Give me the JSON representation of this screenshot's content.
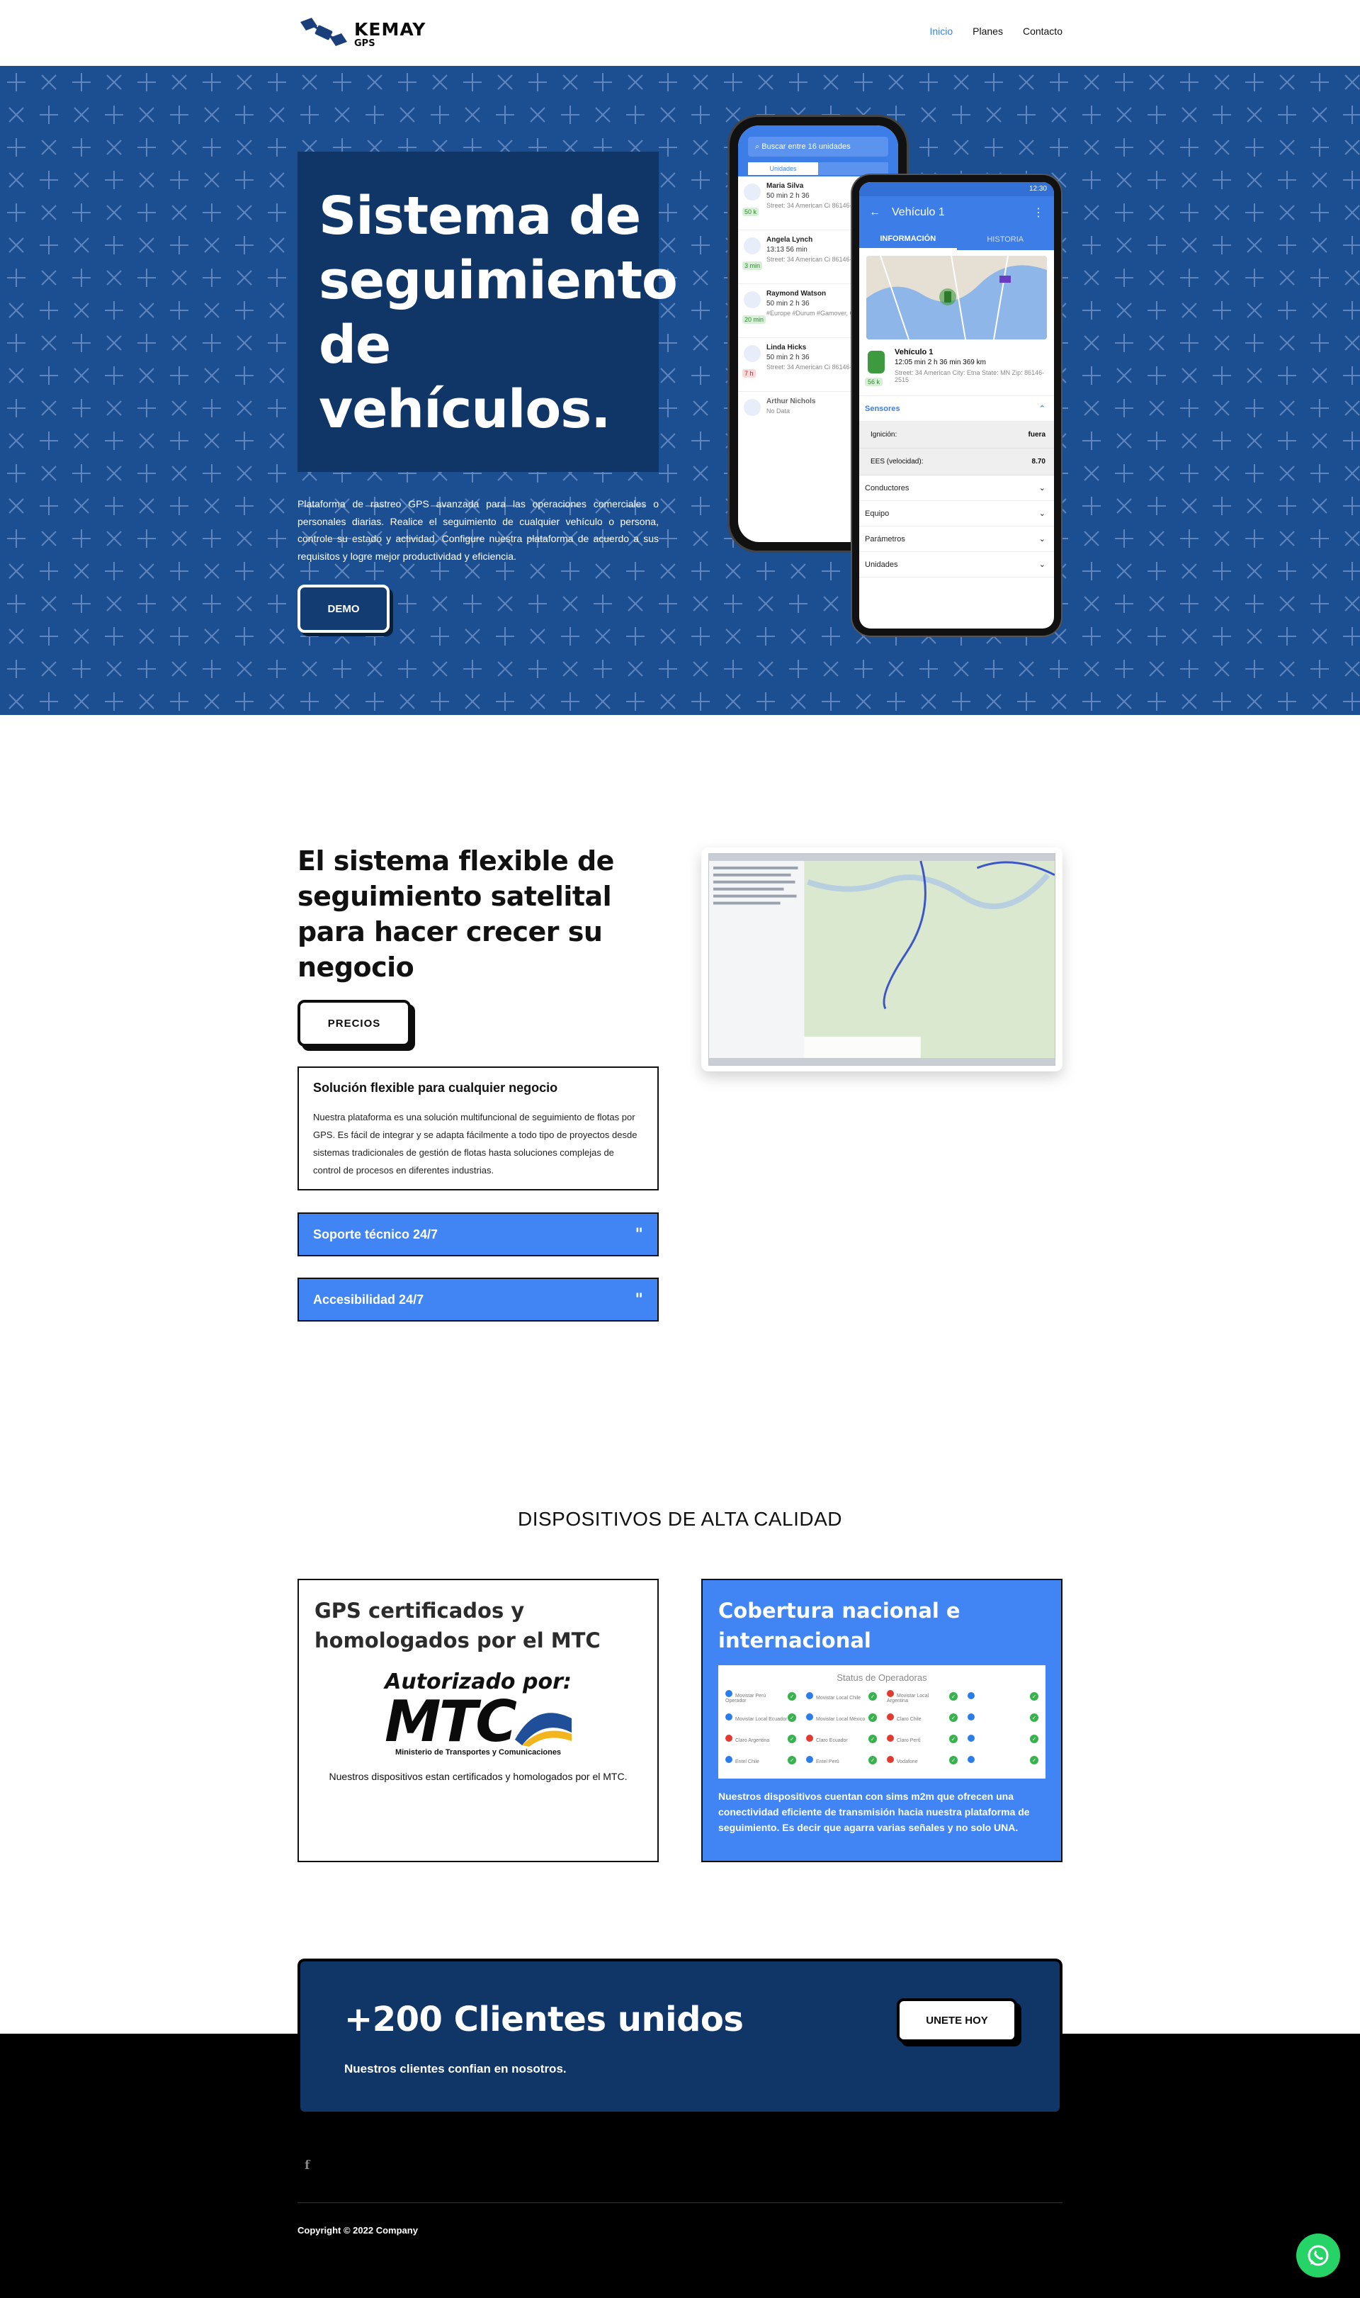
{
  "header": {
    "logo_name": "KEMAY",
    "logo_sub": "GPS",
    "nav": [
      "Inicio",
      "Planes",
      "Contacto"
    ]
  },
  "hero": {
    "title": "Sistema de seguimiento de vehículos.",
    "description": "Plataforma de rastreo GPS avanzada para las operaciones comerciales o personales diarias. Realice el seguimiento de cualquier vehículo o persona, controle su estado y actividad. Configure nuestra plataforma de acuerdo a sus requisitos y logre mejor productividad y eficiencia.",
    "demo_label": "DEMO",
    "phone_back": {
      "search": "Buscar entre 16 unidades",
      "tabs": [
        "Unidades",
        ""
      ],
      "rows": [
        {
          "name": "Maria Silva",
          "stat": "50 min   2 h 36",
          "line": "Street: 34 American Ci 86146-2515",
          "tag": "50 k"
        },
        {
          "name": "Angela Lynch",
          "stat": "13:13   56 min",
          "line": "Street: 34 American Ci 86146-2515",
          "tag": "3 min"
        },
        {
          "name": "Raymond Watson",
          "stat": "50 min   2 h 36",
          "line": "#Europe  #Durum #Gamover, German",
          "tag": "20 min"
        },
        {
          "name": "Linda Hicks",
          "stat": "50 min   2 h 36",
          "line": "Street: 34 American Ci 86146-2515",
          "tag": "7 h"
        },
        {
          "name": "Arthur Nichols",
          "stat": "",
          "line": "No Data",
          "tag": ""
        }
      ]
    },
    "phone_front": {
      "status_time": "12:30",
      "title": "Vehículo 1",
      "tabs": [
        "INFORMACIÓN",
        "HISTORIA"
      ],
      "vehicle_name": "Vehículo 1",
      "vehicle_stat": "12:05 min   2 h 36 min   369 km",
      "vehicle_line": "Street: 34 American City: Etna State: MN Zip: 86146-2515",
      "vehicle_tag": "56 k",
      "sensors_label": "Sensores",
      "kv": [
        {
          "key": "Ignición:",
          "value": "fuera"
        },
        {
          "key": "EES (velocidad):",
          "value": "8.70"
        }
      ],
      "sections": [
        "Conductores",
        "Equipo",
        "Parámetros",
        "Unidades"
      ]
    }
  },
  "section2": {
    "title": "El sistema flexible de seguimiento satelital para hacer crecer su negocio",
    "precios_label": "PRECIOS",
    "feature_title": "Solución flexible para cualquier negocio",
    "feature_text": "Nuestra plataforma es una solución multifuncional de seguimiento de flotas por GPS. Es fácil de integrar y se adapta fácilmente a todo tipo de proyectos desde sistemas tradicionales de gestión de flotas hasta soluciones complejas de control de procesos en diferentes industrias.",
    "accordion": [
      "Soporte técnico 24/7",
      "Accesibilidad 24/7"
    ]
  },
  "section3": {
    "heading": "DISPOSITIVOS DE ALTA CALIDAD",
    "card_left": {
      "title": "GPS certificados y homologados por el MTC",
      "auth": "Autorizado por:",
      "mtc": "MTC",
      "mtc_sub": "Ministerio de Transportes y Comunicaciones",
      "text": "Nuestros dispositivos estan certificados y homologados por el MTC."
    },
    "card_right": {
      "title": "Cobertura nacional e internacional",
      "operators_title": "Status de Operadoras",
      "operators": [
        "Movistar Perú Operador",
        "Movistar Local Chile",
        "Movistar Local Argentina",
        "",
        "Movistar Local Ecuador",
        "Movistar Local México",
        "Claro Chile",
        "",
        "Claro Argentina",
        "Claro Ecuador",
        "Claro Perú",
        "",
        "Entel Chile",
        "Entel Perú",
        "Vodafone",
        ""
      ],
      "text": "Nuestros dispositivos cuentan con sims m2m que ofrecen una conectividad eficiente de transmisión hacia nuestra plataforma de seguimiento. Es decir que agarra varias señales y no solo UNA."
    }
  },
  "cta": {
    "title": "+200 Clientes unidos",
    "subtitle": "Nuestros clientes confian en nosotros.",
    "button": "UNETE HOY"
  },
  "footer": {
    "social": "f",
    "copyright": "Copyright © 2022 Company"
  },
  "colors": {
    "accent": "#3a82f0",
    "hero_bg": "#1c4f91",
    "navy": "#0f3666",
    "card_blue": "#4185f4",
    "footer_bg": "#000000",
    "whatsapp": "#25d366"
  }
}
